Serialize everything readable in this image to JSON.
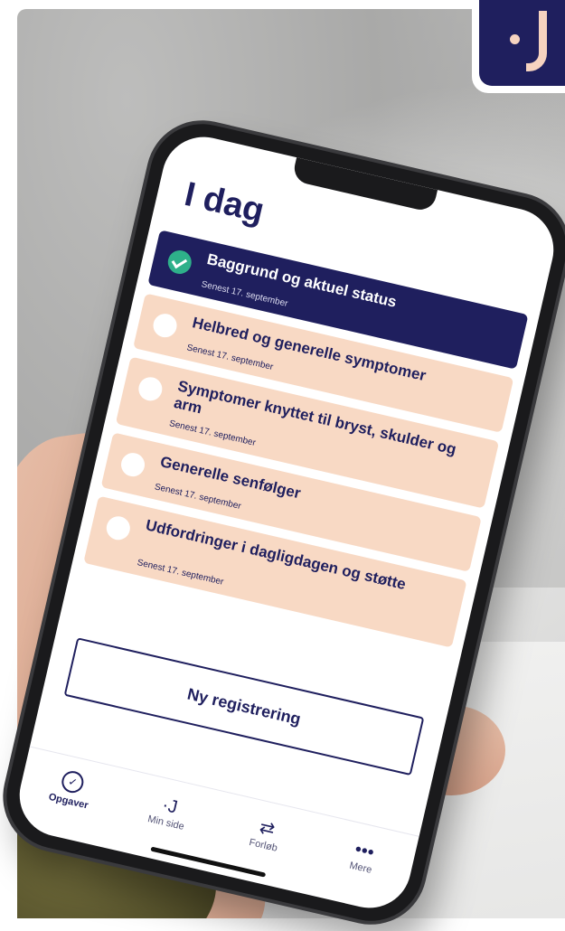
{
  "screen": {
    "title": "I dag"
  },
  "tasks": [
    {
      "label": "Baggrund og aktuel status",
      "subtitle": "Senest 17. september",
      "done": true
    },
    {
      "label": "Helbred og generelle symptomer",
      "subtitle": "Senest 17. september",
      "done": false
    },
    {
      "label": "Symptomer knyttet til bryst, skulder og arm",
      "subtitle": "Senest 17. september",
      "done": false
    },
    {
      "label": "Generelle senfølger",
      "subtitle": "Senest 17. september",
      "done": false
    },
    {
      "label": "Udfordringer i dagligdagen og støtte",
      "subtitle": "Senest 17. september",
      "done": false
    }
  ],
  "new_registration": {
    "label": "Ny registrering"
  },
  "tabbar": {
    "items": [
      {
        "label": "Opgaver",
        "icon": "check-circle-icon",
        "active": true
      },
      {
        "label": "Min side",
        "icon": "app-logo-icon",
        "active": false
      },
      {
        "label": "Forløb",
        "icon": "swap-arrows-icon",
        "active": false
      },
      {
        "label": "Mere",
        "icon": "more-dots-icon",
        "active": false
      }
    ]
  },
  "colors": {
    "brand_navy": "#1f1f5e",
    "task_peach": "#f8d9c4",
    "success_green": "#2eb08a",
    "logo_accent": "#f6d3c0"
  }
}
